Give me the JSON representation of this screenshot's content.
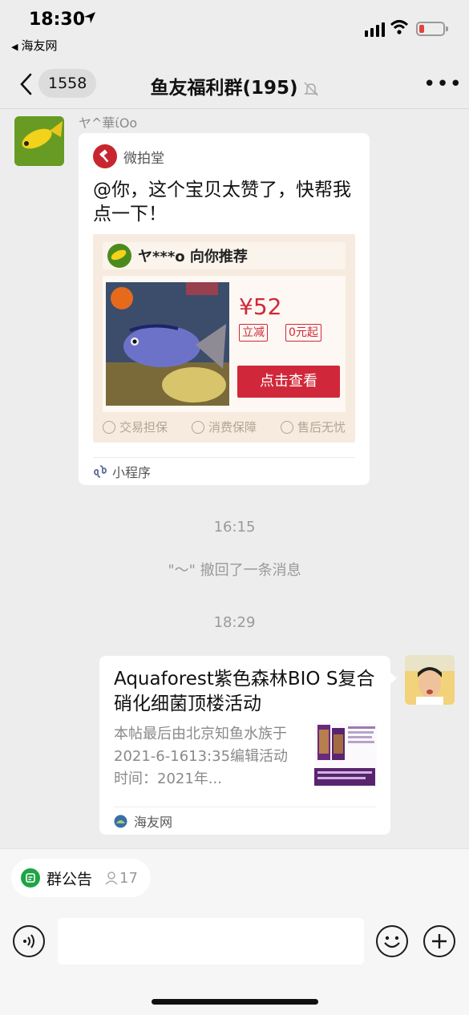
{
  "status_bar": {
    "time": "18:30",
    "back_app": "海友网",
    "icons": [
      "location-arrow-icon",
      "signal-icon",
      "wifi-icon",
      "battery-low-icon"
    ]
  },
  "nav": {
    "unread_count": "1558",
    "title": "鱼友福利群(195)",
    "icons": [
      "back-chevron-icon",
      "mute-bell-icon",
      "more-dots-icon"
    ]
  },
  "messages": {
    "incoming": {
      "sender_name": "ヤ^華ίOo",
      "app_name": "微拍堂",
      "text": "@你，这个宝贝太赞了，快帮我点一下！",
      "promo": {
        "recommender": "ヤ***o 向你推荐",
        "price": "¥52",
        "tags": [
          "立减",
          "0元起"
        ],
        "view_button": "点击查看",
        "guarantees": [
          "交易担保",
          "消费保障",
          "售后无忧"
        ]
      },
      "footer_label": "小程序"
    },
    "timestamp_1": "16:15",
    "recall_notice": "\"～\" 撤回了一条消息",
    "timestamp_2": "18:29",
    "outgoing": {
      "title": "Aquaforest紫色森林BIO S复合硝化细菌顶楼活动",
      "description": "本帖最后由北京知鱼水族于2021-6-1613:35编辑活动时间：2021年...",
      "footer_label": "海友网"
    }
  },
  "bottom": {
    "notice_label": "群公告",
    "notice_count": "17",
    "input_placeholder": "",
    "icons": [
      "group-notice-icon",
      "people-icon",
      "voice-icon",
      "emoji-icon",
      "plus-icon"
    ]
  },
  "colors": {
    "background": "#ededed",
    "accent_red": "#d0283a",
    "wechat_green": "#1ea446",
    "battery_red": "#e6413c"
  }
}
